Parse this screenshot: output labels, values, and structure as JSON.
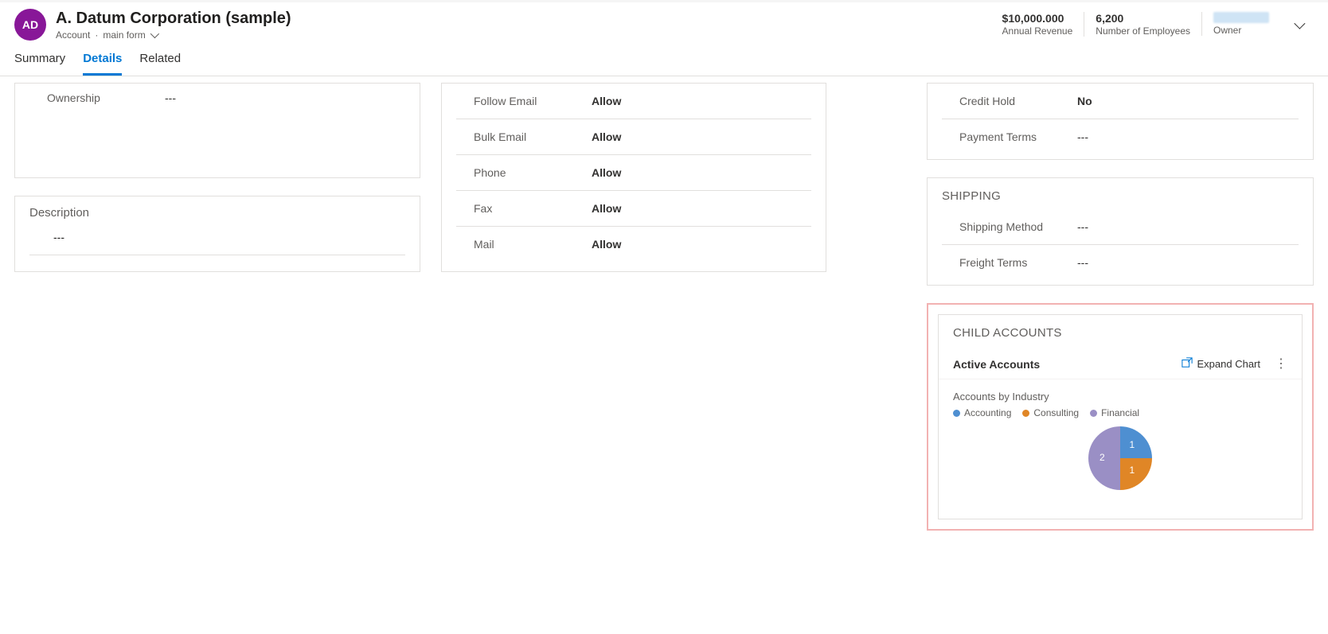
{
  "header": {
    "avatar_initials": "AD",
    "record_title": "A. Datum Corporation (sample)",
    "entity_label": "Account",
    "form_label": "main form",
    "stats": {
      "revenue_value": "$10,000.000",
      "revenue_label": "Annual Revenue",
      "employees_value": "6,200",
      "employees_label": "Number of Employees",
      "owner_label": "Owner"
    }
  },
  "tabs": {
    "summary": "Summary",
    "details": "Details",
    "related": "Related"
  },
  "left": {
    "ownership_label": "Ownership",
    "ownership_value": "---",
    "description_title": "Description",
    "description_value": "---"
  },
  "contact_prefs": {
    "follow_email_label": "Follow Email",
    "follow_email_value": "Allow",
    "bulk_email_label": "Bulk Email",
    "bulk_email_value": "Allow",
    "phone_label": "Phone",
    "phone_value": "Allow",
    "fax_label": "Fax",
    "fax_value": "Allow",
    "mail_label": "Mail",
    "mail_value": "Allow"
  },
  "billing": {
    "credit_hold_label": "Credit Hold",
    "credit_hold_value": "No",
    "payment_terms_label": "Payment Terms",
    "payment_terms_value": "---"
  },
  "shipping": {
    "section_title": "SHIPPING",
    "method_label": "Shipping Method",
    "method_value": "---",
    "freight_label": "Freight Terms",
    "freight_value": "---"
  },
  "child_accounts": {
    "section_title": "CHILD ACCOUNTS",
    "subtitle": "Active Accounts",
    "expand_label": "Expand Chart",
    "chart_title": "Accounts by Industry",
    "legend_accounting": "Accounting",
    "legend_consulting": "Consulting",
    "legend_financial": "Financial"
  },
  "colors": {
    "accounting": "#4e8fd1",
    "consulting": "#e08626",
    "financial": "#9a8fc5"
  },
  "chart_data": {
    "type": "pie",
    "title": "Accounts by Industry",
    "series": [
      {
        "name": "Accounting",
        "value": 1,
        "color": "#4e8fd1"
      },
      {
        "name": "Consulting",
        "value": 1,
        "color": "#e08626"
      },
      {
        "name": "Financial",
        "value": 2,
        "color": "#9a8fc5"
      }
    ],
    "legend_position": "top"
  }
}
